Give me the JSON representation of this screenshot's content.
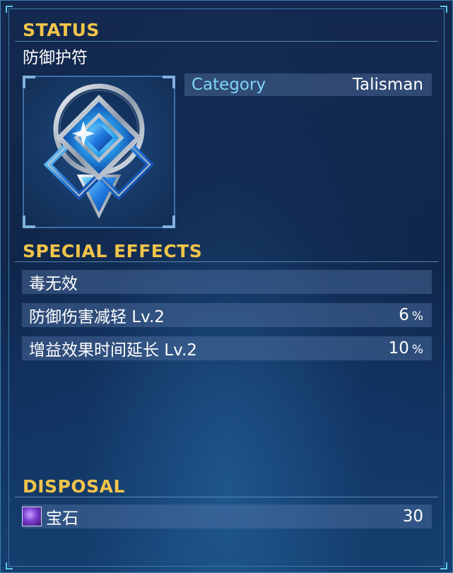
{
  "status": {
    "title": "STATUS",
    "item_name": "防御护符",
    "item_icon": "diamond-talisman-icon",
    "category_label": "Category",
    "category_value": "Talisman"
  },
  "special_effects": {
    "title": "SPECIAL EFFECTS",
    "items": [
      {
        "label": "毒无效",
        "value": "",
        "unit": ""
      },
      {
        "label": "防御伤害减轻 Lv.2",
        "value": "6",
        "unit": "%"
      },
      {
        "label": "增益效果时间延长 Lv.2",
        "value": "10",
        "unit": "%"
      }
    ]
  },
  "disposal": {
    "title": "DISPOSAL",
    "item_icon": "gem-icon",
    "item_label": "宝石",
    "item_value": "30"
  },
  "colors": {
    "section_title": "#f1c44a",
    "category_label": "#7ed6ee",
    "row_background": "#587aaa"
  }
}
